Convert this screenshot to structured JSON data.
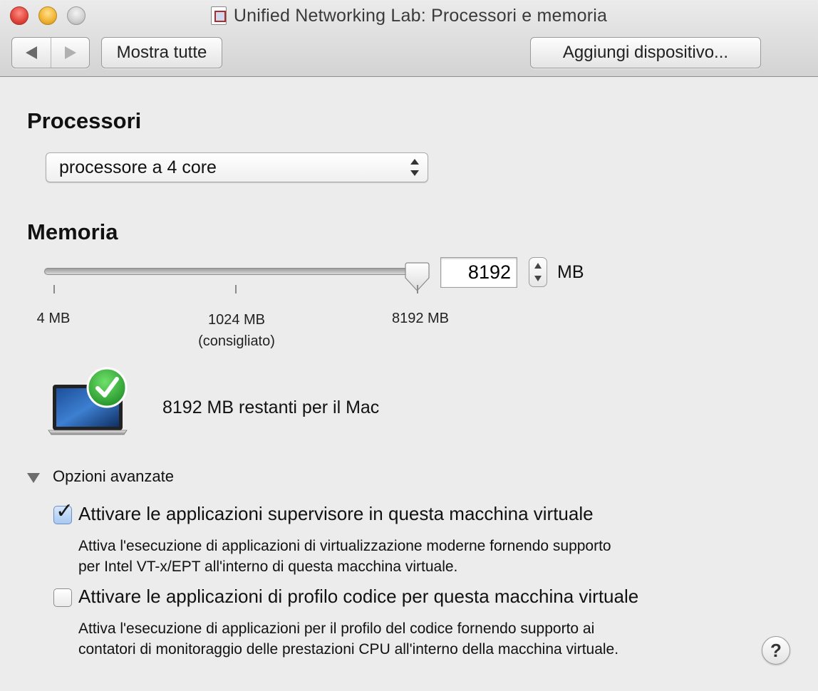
{
  "window": {
    "title": "Unified Networking Lab: Processori e memoria"
  },
  "toolbar": {
    "back_icon": "chevron-left-icon",
    "forward_icon": "chevron-right-icon",
    "show_all_label": "Mostra tutte",
    "add_device_label": "Aggiungi dispositivo..."
  },
  "processors": {
    "heading": "Processori",
    "selected": "processore a 4 core"
  },
  "memory": {
    "heading": "Memoria",
    "value": "8192",
    "unit": "MB",
    "slider_fraction": 1.0,
    "ticks": [
      {
        "label": "4 MB",
        "note": ""
      },
      {
        "label": "1024 MB",
        "note": "(consigliato)"
      },
      {
        "label": "8192 MB",
        "note": ""
      }
    ],
    "remaining_text": "8192 MB restanti per il Mac",
    "status_icon": "laptop-checkmark-icon"
  },
  "advanced": {
    "label": "Opzioni avanzate",
    "options": [
      {
        "checked": true,
        "title": "Attivare le applicazioni supervisore in questa macchina virtuale",
        "desc_line1": "Attiva l'esecuzione di applicazioni di virtualizzazione moderne fornendo supporto",
        "desc_line2": "per Intel VT-x/EPT all'interno di questa macchina virtuale."
      },
      {
        "checked": false,
        "title": "Attivare le applicazioni di profilo codice per questa macchina virtuale",
        "desc_line1": "Attiva l'esecuzione di applicazioni per il profilo del codice fornendo supporto ai",
        "desc_line2": "contatori di monitoraggio delle prestazioni CPU all'interno della macchina virtuale."
      }
    ]
  },
  "help": {
    "label": "?"
  },
  "colors": {
    "window_bg": "#ececec",
    "check_green": "#2fae34",
    "checkbox_checked": "#a8c9f1"
  }
}
